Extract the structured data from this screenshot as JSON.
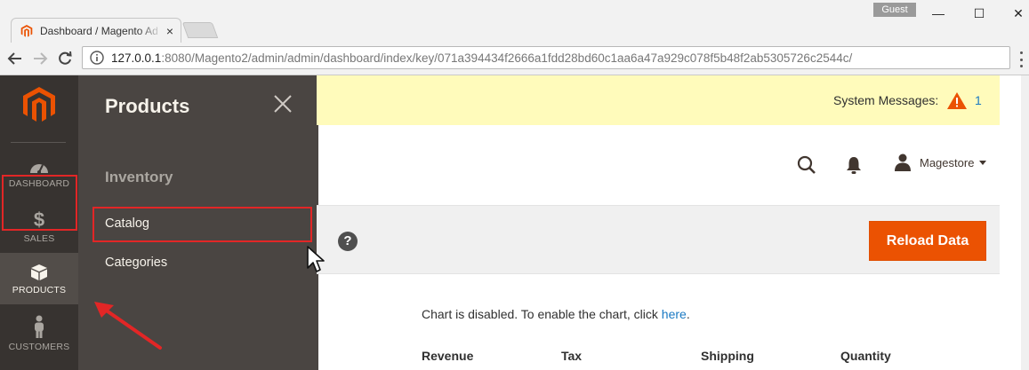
{
  "browser": {
    "tab_title": "Dashboard / Magento Ad",
    "tab_close": "×",
    "profile_badge": "Guest",
    "url_host": "127.0.0.1",
    "url_path": ":8080/Magento2/admin/admin/dashboard/index/key/071a394434f2666a1fdd28bd60c1aa6a47a929c078f5b48f2ab5305726c2544c/",
    "window_min": "—",
    "window_max": "☐",
    "window_close": "✕"
  },
  "sidebar": {
    "items": [
      {
        "label": "DASHBOARD",
        "icon": "dashboard-icon"
      },
      {
        "label": "SALES",
        "icon": "dollar-icon"
      },
      {
        "label": "PRODUCTS",
        "icon": "box-icon"
      },
      {
        "label": "CUSTOMERS",
        "icon": "person-icon"
      }
    ]
  },
  "flyout": {
    "title": "Products",
    "section_inventory": "Inventory",
    "link_catalog": "Catalog",
    "link_categories": "Categories"
  },
  "system_messages": {
    "label": "System Messages:",
    "count": "1"
  },
  "header": {
    "user_name": "Magestore"
  },
  "dashboard": {
    "help_glyph": "?",
    "reload_label": "Reload Data",
    "chart_msg_prefix": "Chart is disabled. To enable the chart, click ",
    "chart_msg_link": "here",
    "chart_msg_suffix": ".",
    "columns": [
      "Revenue",
      "Tax",
      "Shipping",
      "Quantity"
    ]
  },
  "colors": {
    "sidebar_bg": "#373330",
    "flyout_bg": "#4a4542",
    "accent_orange": "#eb5202",
    "annotation_red": "#e22626",
    "link_blue": "#1979c3",
    "system_bar_bg": "#fffbbb"
  }
}
